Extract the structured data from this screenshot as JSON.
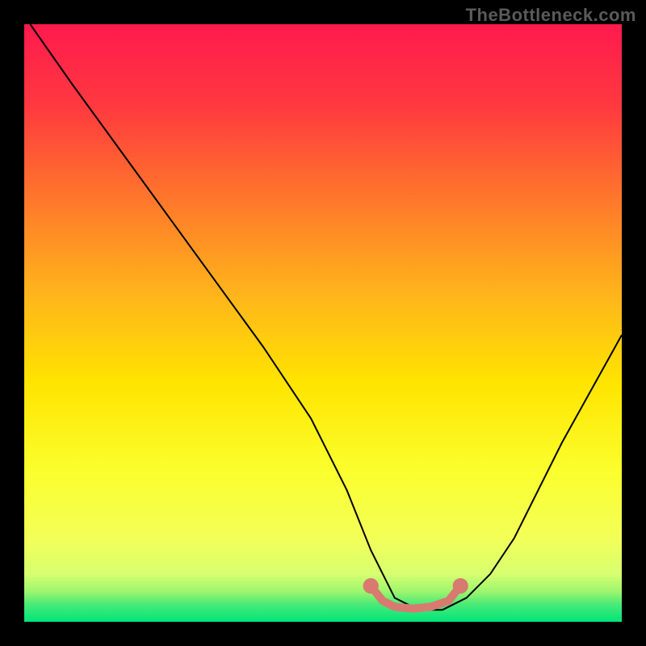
{
  "watermark": "TheBottleneck.com",
  "chart_data": {
    "type": "line",
    "title": "",
    "xlabel": "",
    "ylabel": "",
    "xlim": [
      0,
      100
    ],
    "ylim": [
      0,
      100
    ],
    "grid": false,
    "background": {
      "top_color": "#ff1a4d",
      "mid_high_color": "#ff8a1f",
      "mid_color": "#ffe400",
      "mid_low_color": "#f3ff3a",
      "bottom_color": "#00e57a"
    },
    "series": [
      {
        "name": "bottleneck-curve",
        "color": "#000000",
        "x": [
          1,
          8,
          16,
          24,
          32,
          40,
          48,
          54,
          58,
          62,
          66,
          70,
          74,
          78,
          82,
          86,
          90,
          95,
          100
        ],
        "y": [
          100,
          90,
          79,
          68,
          57,
          46,
          34,
          22,
          12,
          4,
          2,
          2,
          4,
          8,
          14,
          22,
          30,
          39,
          48
        ]
      }
    ],
    "highlight": {
      "name": "optimal-range",
      "color": "#d87a70",
      "x": [
        58,
        60,
        62,
        65,
        68,
        71,
        73
      ],
      "y": [
        6,
        3.5,
        2.5,
        2.2,
        2.5,
        3.5,
        6
      ]
    }
  }
}
